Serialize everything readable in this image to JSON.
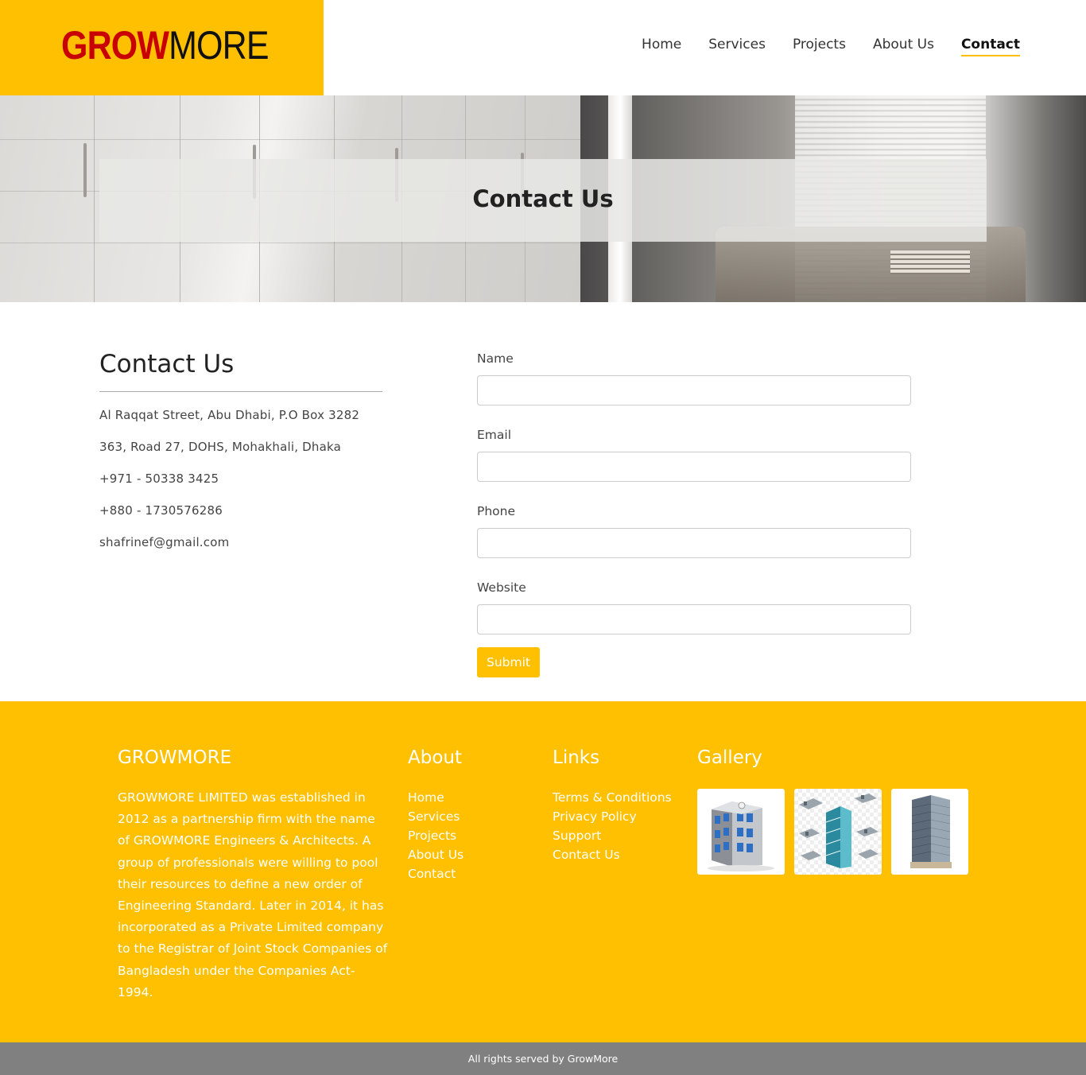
{
  "brand": {
    "logo_part1": "GROW",
    "logo_part2": "MORE"
  },
  "nav": {
    "items": [
      {
        "label": "Home"
      },
      {
        "label": "Services"
      },
      {
        "label": "Projects"
      },
      {
        "label": "About Us"
      },
      {
        "label": "Contact",
        "active": true
      }
    ]
  },
  "hero": {
    "title": "Contact Us"
  },
  "contact": {
    "heading": "Contact Us",
    "lines": [
      "Al Raqqat Street, Abu Dhabi, P.O Box 3282",
      "363, Road 27, DOHS, Mohakhali, Dhaka",
      "+971 - 50338 3425",
      "+880 - 1730576286",
      "shafrinef@gmail.com"
    ]
  },
  "form": {
    "name_label": "Name",
    "name_value": "",
    "email_label": "Email",
    "email_value": "",
    "phone_label": "Phone",
    "phone_value": "",
    "website_label": "Website",
    "website_value": "",
    "submit_label": "Submit"
  },
  "footer": {
    "brand_heading": "GROWMORE",
    "brand_text": "GROWMORE LIMITED was established in 2012 as a partnership firm with the name of GROWMORE Engineers & Architects. A group of professionals were willing to pool their resources to define a new order of Engineering Standard. Later in 2014, it has incorporated as a Private Limited company to the Registrar of Joint Stock Companies of Bangladesh under the Companies Act-1994.",
    "about_heading": "About",
    "about_links": [
      "Home",
      "Services",
      "Projects",
      "About Us",
      "Contact"
    ],
    "links_heading": "Links",
    "links": [
      "Terms & Conditions",
      "Privacy Policy",
      "Support",
      "Contact Us"
    ],
    "gallery_heading": "Gallery",
    "gallery_icons": [
      "office-building-icon",
      "building-plan-icon",
      "skyscraper-icon"
    ],
    "copyright": "All rights served by GrowMore"
  },
  "colors": {
    "accent": "#fec000",
    "logo_red": "#c90000",
    "footer_bar": "#808080"
  }
}
